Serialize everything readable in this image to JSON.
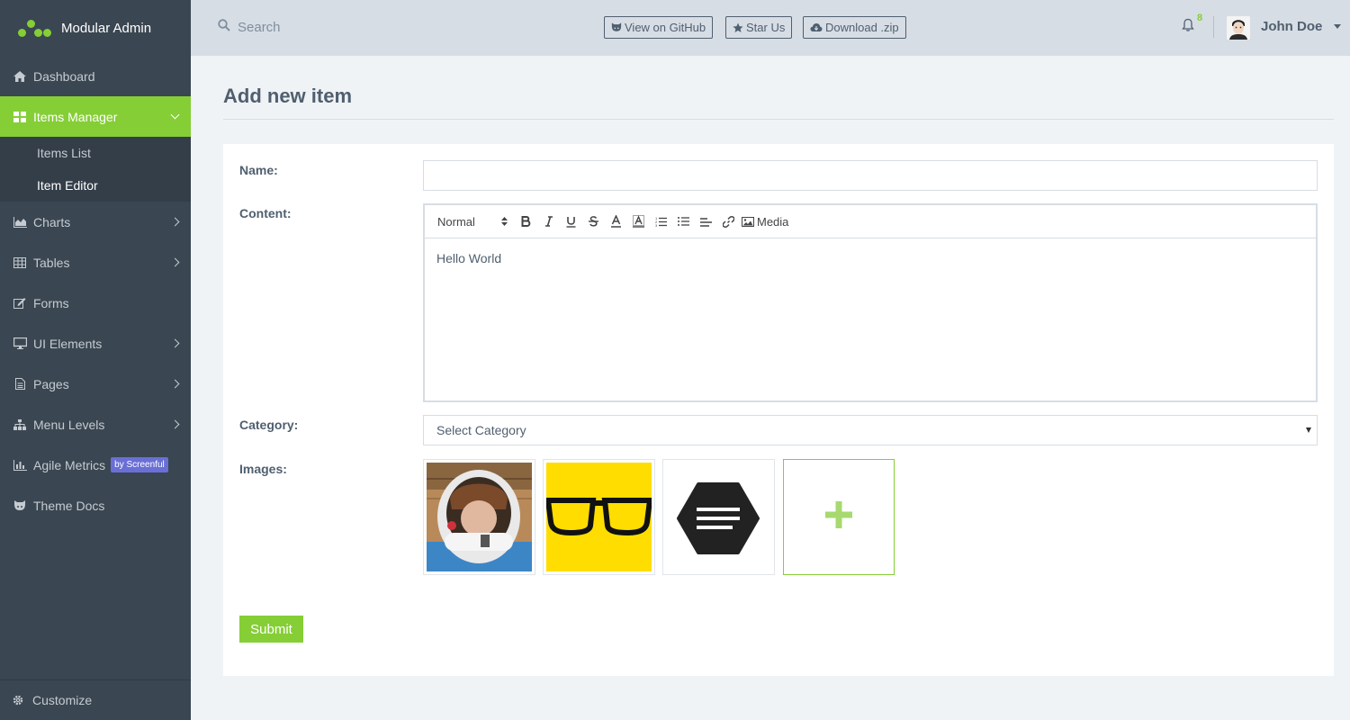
{
  "brand": {
    "title": "Modular Admin"
  },
  "sidebar": {
    "items": [
      {
        "label": "Dashboard",
        "icon": "home-icon"
      },
      {
        "label": "Items Manager",
        "icon": "grid-icon",
        "active": true,
        "children": [
          {
            "label": "Items List"
          },
          {
            "label": "Item Editor",
            "current": true
          }
        ]
      },
      {
        "label": "Charts",
        "icon": "area-chart-icon"
      },
      {
        "label": "Tables",
        "icon": "table-icon"
      },
      {
        "label": "Forms",
        "icon": "edit-icon"
      },
      {
        "label": "UI Elements",
        "icon": "desktop-icon"
      },
      {
        "label": "Pages",
        "icon": "file-icon"
      },
      {
        "label": "Menu Levels",
        "icon": "sitemap-icon"
      },
      {
        "label": "Agile Metrics",
        "icon": "bar-chart-icon",
        "badge": "by Screenful"
      },
      {
        "label": "Theme Docs",
        "icon": "github-icon"
      }
    ],
    "footer": {
      "label": "Customize",
      "icon": "gear-icon"
    }
  },
  "header": {
    "search_placeholder": "Search",
    "buttons": {
      "github": "View on GitHub",
      "star": "Star Us",
      "download": "Download .zip"
    },
    "notifications_count": "8",
    "user_name": "John Doe"
  },
  "page": {
    "title": "Add new item",
    "form": {
      "name_label": "Name:",
      "name_value": "",
      "content_label": "Content:",
      "toolbar": {
        "format": "Normal",
        "media": "Media"
      },
      "content_text": "Hello World",
      "category_label": "Category:",
      "category_value": "Select Category",
      "images_label": "Images:",
      "submit_label": "Submit"
    }
  },
  "colors": {
    "accent": "#85ce36",
    "sidebar": "#3a4651",
    "header": "#d7dde4",
    "badge": "#6a6fd5"
  }
}
